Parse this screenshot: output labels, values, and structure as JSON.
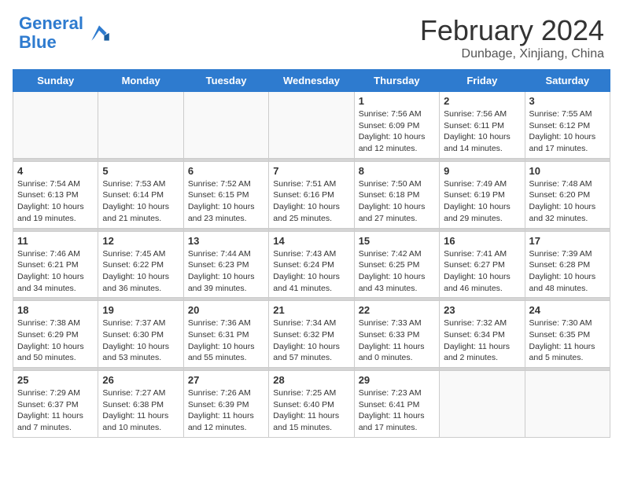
{
  "header": {
    "logo_text1": "General",
    "logo_text2": "Blue",
    "month_title": "February 2024",
    "location": "Dunbage, Xinjiang, China"
  },
  "calendar": {
    "days_of_week": [
      "Sunday",
      "Monday",
      "Tuesday",
      "Wednesday",
      "Thursday",
      "Friday",
      "Saturday"
    ],
    "weeks": [
      {
        "days": [
          {
            "number": "",
            "info": "",
            "empty": true
          },
          {
            "number": "",
            "info": "",
            "empty": true
          },
          {
            "number": "",
            "info": "",
            "empty": true
          },
          {
            "number": "",
            "info": "",
            "empty": true
          },
          {
            "number": "1",
            "info": "Sunrise: 7:56 AM\nSunset: 6:09 PM\nDaylight: 10 hours\nand 12 minutes.",
            "empty": false
          },
          {
            "number": "2",
            "info": "Sunrise: 7:56 AM\nSunset: 6:11 PM\nDaylight: 10 hours\nand 14 minutes.",
            "empty": false
          },
          {
            "number": "3",
            "info": "Sunrise: 7:55 AM\nSunset: 6:12 PM\nDaylight: 10 hours\nand 17 minutes.",
            "empty": false
          }
        ]
      },
      {
        "days": [
          {
            "number": "4",
            "info": "Sunrise: 7:54 AM\nSunset: 6:13 PM\nDaylight: 10 hours\nand 19 minutes.",
            "empty": false
          },
          {
            "number": "5",
            "info": "Sunrise: 7:53 AM\nSunset: 6:14 PM\nDaylight: 10 hours\nand 21 minutes.",
            "empty": false
          },
          {
            "number": "6",
            "info": "Sunrise: 7:52 AM\nSunset: 6:15 PM\nDaylight: 10 hours\nand 23 minutes.",
            "empty": false
          },
          {
            "number": "7",
            "info": "Sunrise: 7:51 AM\nSunset: 6:16 PM\nDaylight: 10 hours\nand 25 minutes.",
            "empty": false
          },
          {
            "number": "8",
            "info": "Sunrise: 7:50 AM\nSunset: 6:18 PM\nDaylight: 10 hours\nand 27 minutes.",
            "empty": false
          },
          {
            "number": "9",
            "info": "Sunrise: 7:49 AM\nSunset: 6:19 PM\nDaylight: 10 hours\nand 29 minutes.",
            "empty": false
          },
          {
            "number": "10",
            "info": "Sunrise: 7:48 AM\nSunset: 6:20 PM\nDaylight: 10 hours\nand 32 minutes.",
            "empty": false
          }
        ]
      },
      {
        "days": [
          {
            "number": "11",
            "info": "Sunrise: 7:46 AM\nSunset: 6:21 PM\nDaylight: 10 hours\nand 34 minutes.",
            "empty": false
          },
          {
            "number": "12",
            "info": "Sunrise: 7:45 AM\nSunset: 6:22 PM\nDaylight: 10 hours\nand 36 minutes.",
            "empty": false
          },
          {
            "number": "13",
            "info": "Sunrise: 7:44 AM\nSunset: 6:23 PM\nDaylight: 10 hours\nand 39 minutes.",
            "empty": false
          },
          {
            "number": "14",
            "info": "Sunrise: 7:43 AM\nSunset: 6:24 PM\nDaylight: 10 hours\nand 41 minutes.",
            "empty": false
          },
          {
            "number": "15",
            "info": "Sunrise: 7:42 AM\nSunset: 6:25 PM\nDaylight: 10 hours\nand 43 minutes.",
            "empty": false
          },
          {
            "number": "16",
            "info": "Sunrise: 7:41 AM\nSunset: 6:27 PM\nDaylight: 10 hours\nand 46 minutes.",
            "empty": false
          },
          {
            "number": "17",
            "info": "Sunrise: 7:39 AM\nSunset: 6:28 PM\nDaylight: 10 hours\nand 48 minutes.",
            "empty": false
          }
        ]
      },
      {
        "days": [
          {
            "number": "18",
            "info": "Sunrise: 7:38 AM\nSunset: 6:29 PM\nDaylight: 10 hours\nand 50 minutes.",
            "empty": false
          },
          {
            "number": "19",
            "info": "Sunrise: 7:37 AM\nSunset: 6:30 PM\nDaylight: 10 hours\nand 53 minutes.",
            "empty": false
          },
          {
            "number": "20",
            "info": "Sunrise: 7:36 AM\nSunset: 6:31 PM\nDaylight: 10 hours\nand 55 minutes.",
            "empty": false
          },
          {
            "number": "21",
            "info": "Sunrise: 7:34 AM\nSunset: 6:32 PM\nDaylight: 10 hours\nand 57 minutes.",
            "empty": false
          },
          {
            "number": "22",
            "info": "Sunrise: 7:33 AM\nSunset: 6:33 PM\nDaylight: 11 hours\nand 0 minutes.",
            "empty": false
          },
          {
            "number": "23",
            "info": "Sunrise: 7:32 AM\nSunset: 6:34 PM\nDaylight: 11 hours\nand 2 minutes.",
            "empty": false
          },
          {
            "number": "24",
            "info": "Sunrise: 7:30 AM\nSunset: 6:35 PM\nDaylight: 11 hours\nand 5 minutes.",
            "empty": false
          }
        ]
      },
      {
        "days": [
          {
            "number": "25",
            "info": "Sunrise: 7:29 AM\nSunset: 6:37 PM\nDaylight: 11 hours\nand 7 minutes.",
            "empty": false
          },
          {
            "number": "26",
            "info": "Sunrise: 7:27 AM\nSunset: 6:38 PM\nDaylight: 11 hours\nand 10 minutes.",
            "empty": false
          },
          {
            "number": "27",
            "info": "Sunrise: 7:26 AM\nSunset: 6:39 PM\nDaylight: 11 hours\nand 12 minutes.",
            "empty": false
          },
          {
            "number": "28",
            "info": "Sunrise: 7:25 AM\nSunset: 6:40 PM\nDaylight: 11 hours\nand 15 minutes.",
            "empty": false
          },
          {
            "number": "29",
            "info": "Sunrise: 7:23 AM\nSunset: 6:41 PM\nDaylight: 11 hours\nand 17 minutes.",
            "empty": false
          },
          {
            "number": "",
            "info": "",
            "empty": true
          },
          {
            "number": "",
            "info": "",
            "empty": true
          }
        ]
      }
    ]
  }
}
